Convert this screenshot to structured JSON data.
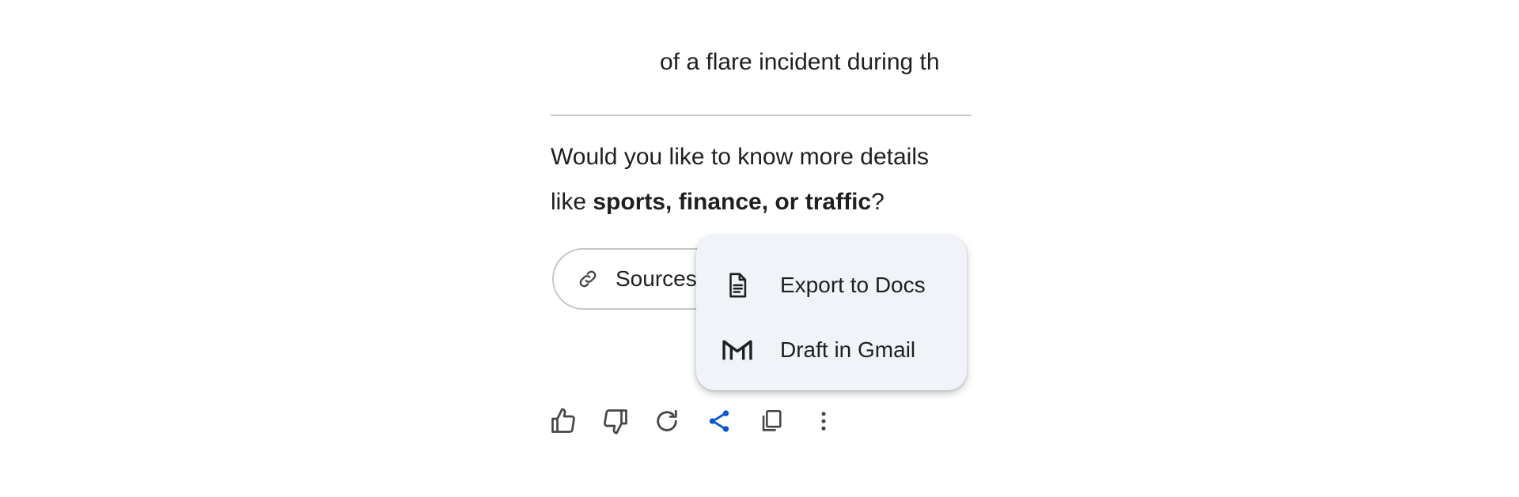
{
  "response": {
    "truncated_line": "of a flare incident during th",
    "question_prefix": "Would you like to know more details",
    "question_line2_prefix": "like ",
    "question_bold": "sports, finance, or traffic",
    "question_suffix": "?"
  },
  "sources_chip": {
    "label": "Sources",
    "icon": "link-icon"
  },
  "share_menu": {
    "items": [
      {
        "label": "Export to Docs",
        "icon": "docs-icon"
      },
      {
        "label": "Draft in Gmail",
        "icon": "gmail-icon"
      }
    ]
  },
  "action_bar": {
    "buttons": [
      {
        "name": "thumbs-up",
        "icon": "thumbs-up-icon"
      },
      {
        "name": "thumbs-down",
        "icon": "thumbs-down-icon"
      },
      {
        "name": "regenerate",
        "icon": "refresh-icon"
      },
      {
        "name": "share",
        "icon": "share-icon",
        "active": true
      },
      {
        "name": "copy",
        "icon": "copy-icon"
      },
      {
        "name": "more",
        "icon": "more-vert-icon"
      }
    ]
  },
  "colors": {
    "text": "#1f1f1f",
    "accent": "#0b57d0",
    "menu_bg": "#f0f4f9",
    "icon": "#444746",
    "divider": "#c7c7c7"
  }
}
